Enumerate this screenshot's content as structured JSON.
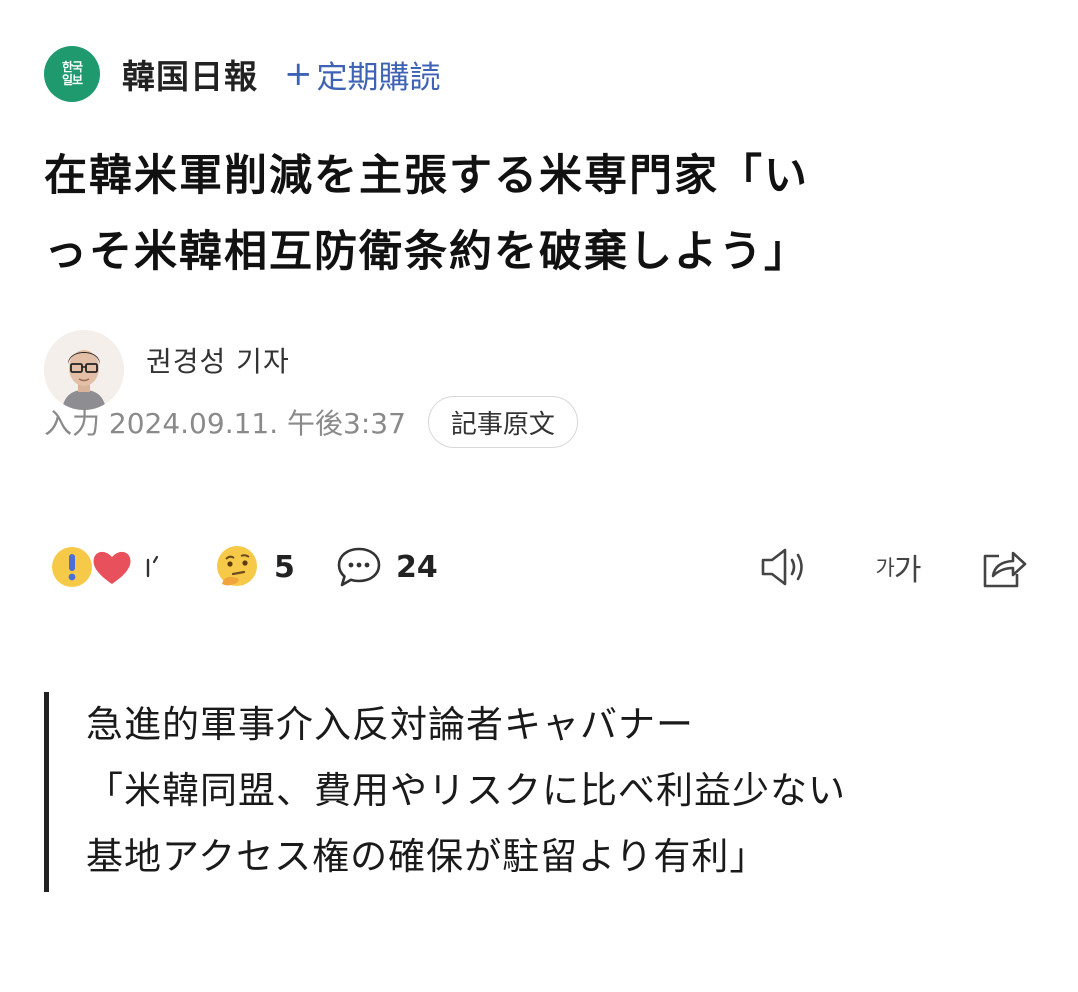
{
  "press": {
    "logo_text_top": "한국",
    "logo_text_bottom": "일보",
    "name": "韓国日報",
    "subscribe_icon": "+",
    "subscribe_label": "定期購読"
  },
  "article": {
    "headline_line1": "在韓米軍削減を主張する米専門家「い",
    "headline_line2": "っそ米韓相互防衛条約を破棄しよう」",
    "reporter": "권경성 기자",
    "published": "入力 2024.09.11. 午後3:37",
    "original_button": "記事原文"
  },
  "actions": {
    "reactions_count": "",
    "thinking_count": "5",
    "comments_count": "24",
    "font_small": "가",
    "font_large": "가"
  },
  "summary": {
    "line1": "急進的軍事介入反対論者キャバナー",
    "line2": "「米韓同盟、費用やリスクに比べ利益少ない",
    "line3": "基地アクセス権の確保が駐留より有利」"
  },
  "icons": {
    "press_logo": "press-logo-icon",
    "reactions": [
      "surprise-emoji-icon",
      "heart-emoji-icon"
    ],
    "thinking": "thinking-emoji-icon",
    "comments": "speech-bubble-icon",
    "audio": "speaker-icon",
    "share": "share-icon"
  },
  "colors": {
    "press_green": "#1f9a6f",
    "subscribe_blue": "#3f63b4",
    "meta_gray": "#8a8a8a"
  }
}
